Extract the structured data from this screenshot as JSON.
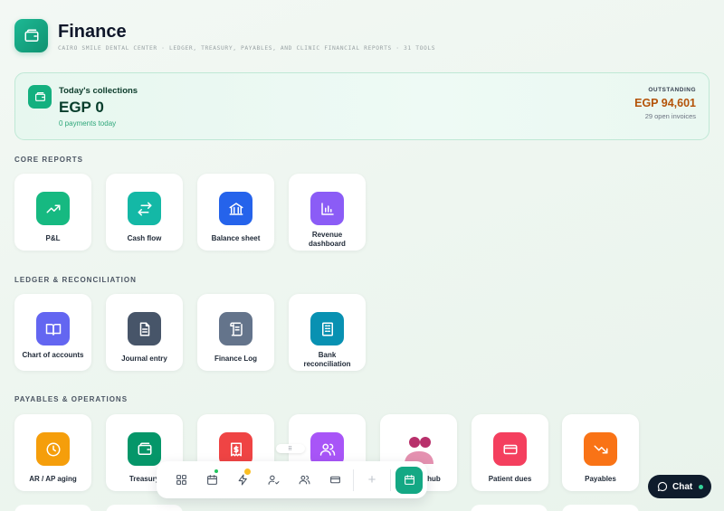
{
  "header": {
    "title": "Finance",
    "subtitle": "CAIRO SMILE DENTAL CENTER · LEDGER, TREASURY, PAYABLES, AND CLINIC FINANCIAL REPORTS · 31 TOOLS",
    "icon": "wallet-icon"
  },
  "collections": {
    "label": "Today's collections",
    "amount": "EGP 0",
    "sub": "0 payments today",
    "outstanding_label": "OUTSTANDING",
    "outstanding_amount": "EGP 94,601",
    "outstanding_sub": "29 open invoices"
  },
  "sections": {
    "core": "CORE REPORTS",
    "ledger": "LEDGER & RECONCILIATION",
    "payables": "PAYABLES & OPERATIONS"
  },
  "core_tiles": [
    {
      "label": "P&L",
      "icon": "trend-up-icon",
      "color": "#16b981"
    },
    {
      "label": "Cash flow",
      "icon": "swap-arrows-icon",
      "color": "#14b8a6"
    },
    {
      "label": "Balance sheet",
      "icon": "bank-icon",
      "color": "#2563eb"
    },
    {
      "label": "Revenue dashboard",
      "icon": "bar-chart-icon",
      "color": "#8b5cf6"
    }
  ],
  "ledger_tiles": [
    {
      "label": "Chart of accounts",
      "icon": "book-icon",
      "color": "#6366f1"
    },
    {
      "label": "Journal entry",
      "icon": "document-icon",
      "color": "#475569"
    },
    {
      "label": "Finance Log",
      "icon": "scroll-icon",
      "color": "#64748b"
    },
    {
      "label": "Bank reconciliation",
      "icon": "building-icon",
      "color": "#0891b2"
    }
  ],
  "payables_tiles": [
    {
      "label": "AR / AP aging",
      "icon": "clock-icon",
      "color": "#f59e0b"
    },
    {
      "label": "Treasury",
      "icon": "wallet-icon",
      "color": "#059669"
    },
    {
      "label": "",
      "icon": "receipt-icon",
      "color": "#ef4444"
    },
    {
      "label": "",
      "icon": "users-icon",
      "color": "#a855f7"
    },
    {
      "label": "hub",
      "icon": "people-icon",
      "color": "#db2777"
    },
    {
      "label": "Patient dues",
      "icon": "card-icon",
      "color": "#f43f5e"
    },
    {
      "label": "Payables",
      "icon": "trend-down-icon",
      "color": "#f97316"
    }
  ],
  "dock": {
    "items": [
      "grid-icon",
      "calendar-icon",
      "bolt-icon",
      "user-check-icon",
      "users-icon",
      "card-icon",
      "plus-icon",
      "calendar-icon"
    ],
    "plus_label": "+"
  },
  "drag_handle": "⠿",
  "chat": {
    "label": "Chat"
  }
}
